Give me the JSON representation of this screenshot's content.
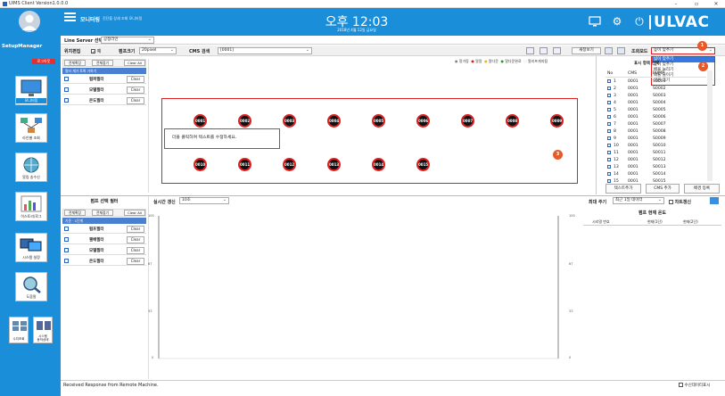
{
  "window": {
    "title": "UIMS Client Version1.0.0.0",
    "min": "–",
    "max": "▫",
    "close": "✕"
  },
  "header": {
    "menu_title": "모니터링",
    "menu_sub": "진단을 상세 조회 모니터링",
    "clock": "오후 12:03",
    "date": "2018년 4월 12일 금요일",
    "logo": "ULVAC"
  },
  "sidebar": {
    "user": "SetupManager",
    "user_sub": "SetupManager",
    "logout": "로그아웃",
    "nav": [
      "모니터링",
      "라인별 조회",
      "알림 송수신",
      "히스토리/로그",
      "시스템 설정",
      "도움말"
    ],
    "small_nav": [
      "수치조회",
      "시스템\n동작상태"
    ]
  },
  "line_select": {
    "label": "Line Server 선택",
    "value": "공정라인"
  },
  "toolbar": {
    "pos_edit": "위치편집",
    "pos_edit_value": "예",
    "pump_size": "펌프크기",
    "pump_size_value": "20pixel",
    "cms_label": "CMS 검색",
    "cms_value": "[0001]",
    "view_mode": "조회모드",
    "view_mode_value": "높이 맞추기",
    "new": "새창보기"
  },
  "dropdown_options": [
    "넓이 맞추기",
    "높이 맞추기",
    "배율 늘리기",
    "배율 줄이기",
    "기본 크기"
  ],
  "legend": [
    "정가동",
    "알람",
    "알다운",
    "알다운완료",
    "알리프게지됨"
  ],
  "top_filter": {
    "expand": "전체확장",
    "collapse": "전체접기",
    "clear_all": "Clear All",
    "note": "필터 계가 토록 가하기",
    "rows": [
      {
        "name": "펌퍼필터",
        "clear": "Clear"
      },
      {
        "name": "모델필터",
        "clear": "Clear"
      },
      {
        "name": "온도필터",
        "clear": "Clear"
      }
    ]
  },
  "pumps_row1": [
    "0001",
    "0002",
    "0003",
    "0004",
    "0005",
    "0006",
    "0007",
    "0008",
    "0009"
  ],
  "pumps_row2": [
    "0010",
    "0011",
    "0012",
    "0013",
    "0014",
    "0015"
  ],
  "text_box": "더블 클릭하여 텍스트를 수정하세요.",
  "list": {
    "title": "표시 항목 선택",
    "headers": [
      "No",
      "CMS",
      "PUMP"
    ],
    "rows": [
      [
        "1",
        "0001",
        "S0001"
      ],
      [
        "2",
        "0001",
        "S0002"
      ],
      [
        "3",
        "0001",
        "S0003"
      ],
      [
        "4",
        "0001",
        "S0004"
      ],
      [
        "5",
        "0001",
        "S0005"
      ],
      [
        "6",
        "0001",
        "S0006"
      ],
      [
        "7",
        "0001",
        "S0007"
      ],
      [
        "8",
        "0001",
        "S0008"
      ],
      [
        "9",
        "0001",
        "S0009"
      ],
      [
        "10",
        "0001",
        "S0010"
      ],
      [
        "11",
        "0001",
        "S0011"
      ],
      [
        "12",
        "0001",
        "S0012"
      ],
      [
        "13",
        "0001",
        "S0013"
      ],
      [
        "14",
        "0001",
        "S0014"
      ],
      [
        "15",
        "0001",
        "S0015"
      ]
    ],
    "text_add": "텍스트추가",
    "cms_add": "CMS 추가",
    "bg_reg": "배경 등록"
  },
  "bottom_filter": {
    "title": "펌프 선택 필터",
    "expand": "전체확장",
    "collapse": "전체접기",
    "clear_all": "Clear All",
    "note": "기준 · 1단계",
    "rows": [
      {
        "name": "펌프필터",
        "clear": "Clear"
      },
      {
        "name": "웬배필터",
        "clear": "Clear"
      },
      {
        "name": "모델필터",
        "clear": "Clear"
      },
      {
        "name": "온도필터",
        "clear": "Clear"
      }
    ]
  },
  "realtime": {
    "label": "실시간 갱신",
    "value": "10초"
  },
  "chart": {
    "yticks": [
      "100",
      "67",
      "33",
      "0"
    ]
  },
  "max_period": {
    "label": "최대 주기",
    "value": "최근 1일 데이터",
    "sort_label": "차트갱신"
  },
  "temp_panel": {
    "title": "펌프 현재 온도",
    "headers": [
      "시리얼 번호",
      "현재(1단)",
      "현재(2단)"
    ]
  },
  "status": {
    "message": "Received Response from Remote Machine.",
    "check_label": "수신데이터표시"
  },
  "badges": [
    "1",
    "2",
    "3"
  ],
  "colors": {
    "header": "#1b8ed9",
    "alarm_red": "#e02020",
    "badge": "#e85a2a"
  }
}
